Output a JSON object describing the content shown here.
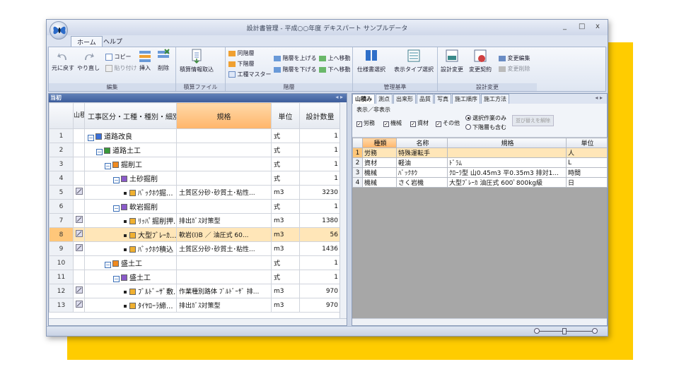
{
  "window": {
    "title": "設計書管理 - 平成○○年度 デキスパート サンプルデータ",
    "controls": [
      "_",
      "□",
      "x"
    ]
  },
  "ribbon_tabs": [
    "ホーム",
    "ヘルプ"
  ],
  "ribbon": {
    "edit": {
      "undo": "元に戻す",
      "redo": "やり直し",
      "copy": "コピー",
      "paste": "貼り付け",
      "insert": "挿入",
      "delete": "削除",
      "label": "編集"
    },
    "file": {
      "import": "積算情報取込",
      "label": "積算ファイル"
    },
    "layer": {
      "same": "同階層",
      "lower": "下階層",
      "master": "工種マスター",
      "up_level": "階層を上げる",
      "down_level": "階層を下げる",
      "move_up": "上へ移動",
      "move_down": "下へ移動",
      "label": "階層"
    },
    "manage": {
      "spec_select": "仕様書選択",
      "display_type": "表示タイプ選択",
      "label": "管理基準"
    },
    "change": {
      "design_change": "設計変更",
      "change_contract": "変更契約",
      "change_edit": "変更編集",
      "change_delete": "変更削除",
      "label": "設計変更"
    }
  },
  "left": {
    "header": "当初",
    "nav": "◂ ▸",
    "columns": {
      "yamazumi": "山積み",
      "item": "工事区分・工種・種別・細別",
      "spec": "規格",
      "unit": "単位",
      "qty": "設計数量"
    },
    "rows": [
      {
        "n": "1",
        "name": "道路改良",
        "spec": "",
        "unit": "式",
        "qty": "1",
        "lvl": 0,
        "ic": "blue",
        "ck": false
      },
      {
        "n": "2",
        "name": "道路土工",
        "spec": "",
        "unit": "式",
        "qty": "1",
        "lvl": 1,
        "ic": "green",
        "ck": false
      },
      {
        "n": "3",
        "name": "掘削工",
        "spec": "",
        "unit": "式",
        "qty": "1",
        "lvl": 2,
        "ic": "orange",
        "ck": false
      },
      {
        "n": "4",
        "name": "土砂掘削",
        "spec": "",
        "unit": "式",
        "qty": "1",
        "lvl": 3,
        "ic": "purple",
        "ck": false
      },
      {
        "n": "5",
        "name": "ﾊﾞｯｸﾎｳ掘...",
        "spec": "土質区分砂･砂質土･粘性...",
        "unit": "m3",
        "qty": "3230",
        "lvl": 4,
        "ic": "leaf",
        "ck": true
      },
      {
        "n": "6",
        "name": "軟岩掘削",
        "spec": "",
        "unit": "式",
        "qty": "1",
        "lvl": 3,
        "ic": "purple",
        "ck": false
      },
      {
        "n": "7",
        "name": "ﾘｯﾊﾟ掘削押...",
        "spec": "排出ｶﾞｽ対策型",
        "unit": "m3",
        "qty": "1380",
        "lvl": 4,
        "ic": "leaf",
        "ck": true
      },
      {
        "n": "8",
        "name": "大型ﾌﾞﾚｰｶ...",
        "spec": "軟岩(Ⅰ)B ／ 油圧式 60...",
        "unit": "m3",
        "qty": "56",
        "lvl": 4,
        "ic": "leaf",
        "ck": true,
        "sel": true
      },
      {
        "n": "9",
        "name": "ﾊﾞｯｸﾎｳ積込",
        "spec": "土質区分砂･砂質土･粘性...",
        "unit": "m3",
        "qty": "1436",
        "lvl": 4,
        "ic": "leaf",
        "ck": true
      },
      {
        "n": "10",
        "name": "盛土工",
        "spec": "",
        "unit": "式",
        "qty": "1",
        "lvl": 2,
        "ic": "orange",
        "ck": false
      },
      {
        "n": "11",
        "name": "盛土工",
        "spec": "",
        "unit": "式",
        "qty": "1",
        "lvl": 3,
        "ic": "purple",
        "ck": false
      },
      {
        "n": "12",
        "name": "ﾌﾞﾙﾄﾞｰｻﾞ敷...",
        "spec": "作業種別路体 ﾌﾞﾙﾄﾞｰｻﾞ 排...",
        "unit": "m3",
        "qty": "970",
        "lvl": 4,
        "ic": "leaf",
        "ck": true
      },
      {
        "n": "13",
        "name": "ﾀｲﾔﾛｰﾗ締...",
        "spec": "排出ｶﾞｽ対策型",
        "unit": "m3",
        "qty": "970",
        "lvl": 4,
        "ic": "leaf",
        "ck": true
      }
    ]
  },
  "right": {
    "tabs": [
      "山積み",
      "測点",
      "出来形",
      "品質",
      "写真",
      "施工順序",
      "施工方法"
    ],
    "nav": "◂ ▸",
    "options": {
      "group_label": "表示／非表示",
      "labor": "労務",
      "machine": "機械",
      "material": "資材",
      "other": "その他",
      "only_selected": "選択作業のみ",
      "include_lower": "下階層も含む",
      "release": "並び替えを解除"
    },
    "columns": {
      "kind": "種類",
      "name": "名称",
      "spec": "規格",
      "unit": "単位"
    },
    "rows": [
      {
        "n": "1",
        "kind": "労務",
        "name": "特殊運転手",
        "spec": "",
        "unit": "人",
        "sel": true
      },
      {
        "n": "2",
        "kind": "資材",
        "name": "軽油",
        "spec": "ﾄﾞﾗﾑ",
        "unit": "L"
      },
      {
        "n": "3",
        "kind": "機械",
        "name": "ﾊﾞｯｸﾎｳ",
        "spec": "ｸﾛｰﾗ型 山0.45m3 平0.35m3 排対1...",
        "unit": "時間"
      },
      {
        "n": "4",
        "kind": "機械",
        "name": "さく岩機",
        "spec": "大型ﾌﾞﾚｰｶ 油圧式 600ﾟ800kg級",
        "unit": "日"
      }
    ]
  },
  "colors": {
    "highlight": "#ffb56a",
    "header": "#3d5d9b",
    "accent": "#ffcc00"
  }
}
